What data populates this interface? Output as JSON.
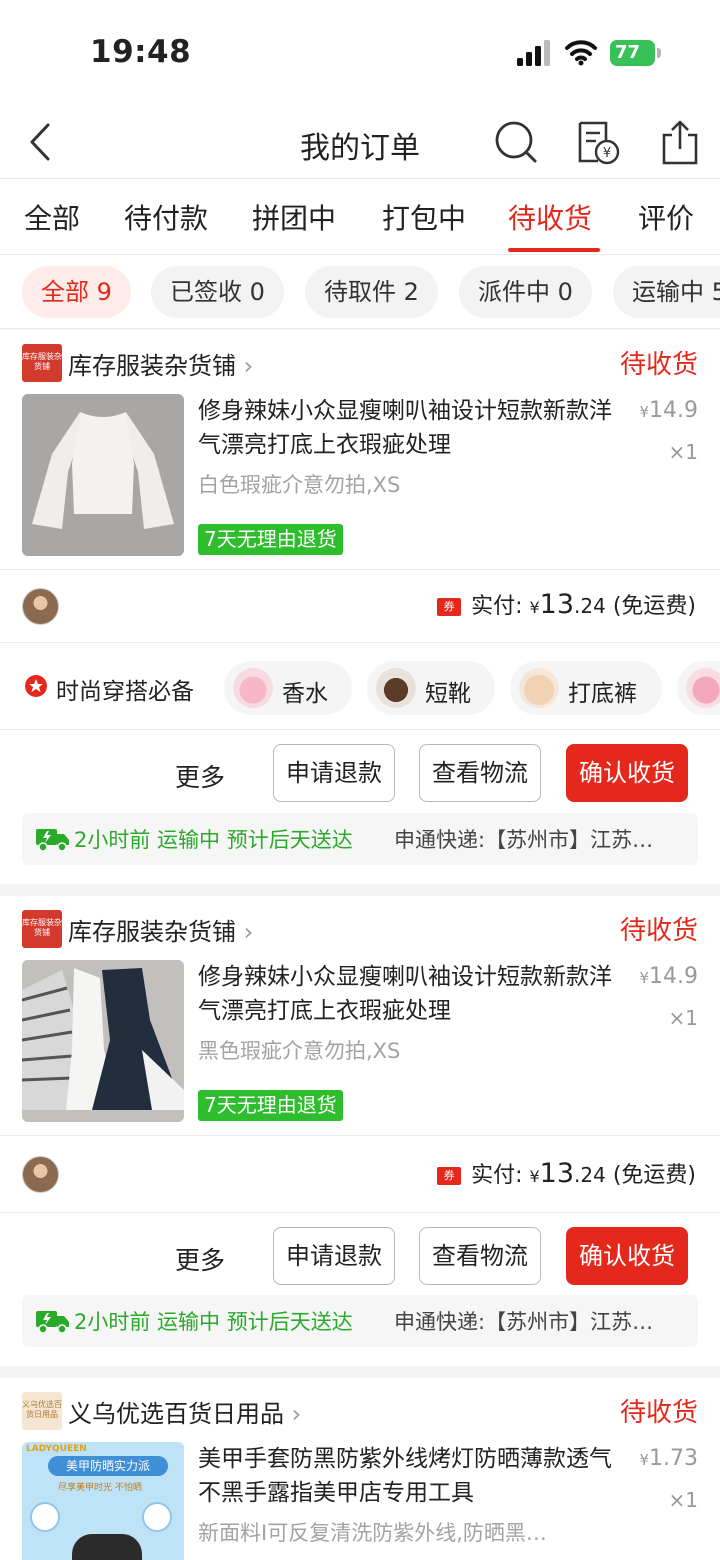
{
  "status_bar": {
    "time": "19:48",
    "battery": "77"
  },
  "nav": {
    "title": "我的订单"
  },
  "tabs": [
    "全部",
    "待付款",
    "拼团中",
    "打包中",
    "待收货",
    "评价"
  ],
  "chips": [
    "全部 9",
    "已签收 0",
    "待取件 2",
    "派件中 0",
    "运输中 5"
  ],
  "orders": [
    {
      "shop_name": "库存服装杂货铺",
      "shop_logo": "库存服装杂货铺",
      "status": "待收货",
      "title": "修身辣妹小众显瘦喇叭袖设计短款新款洋气漂亮打底上衣瑕疵处理",
      "price_symbol": "¥",
      "price": "14.9",
      "qty": "×1",
      "spec": "白色瑕疵介意勿拍,XS",
      "tag": "7天无理由退货",
      "coupon": "券",
      "pay_label": "实付: ",
      "pay_symbol": "¥",
      "pay_int": "13",
      "pay_dec": ".24",
      "pay_note": " (免运费)"
    },
    {
      "shop_name": "库存服装杂货铺",
      "shop_logo": "库存服装杂货铺",
      "status": "待收货",
      "title": "修身辣妹小众显瘦喇叭袖设计短款新款洋气漂亮打底上衣瑕疵处理",
      "price_symbol": "¥",
      "price": "14.9",
      "qty": "×1",
      "spec": "黑色瑕疵介意勿拍,XS",
      "tag": "7天无理由退货",
      "coupon": "券",
      "pay_label": "实付: ",
      "pay_symbol": "¥",
      "pay_int": "13",
      "pay_dec": ".24",
      "pay_note": " (免运费)"
    },
    {
      "shop_name": "义乌优选百货日用品",
      "shop_logo": "义乌优选百货日用品",
      "status": "待收货",
      "title": "美甲手套防黑防紫外线烤灯防晒薄款透气不黑手露指美甲店专用工具",
      "price_symbol": "¥",
      "price": "1.73",
      "qty": "×1",
      "spec": "新面料I可反复清洗防紫外线,防晒黑…",
      "image_text": {
        "brand": "LADYQUEEN",
        "headline": "美甲防晒实力派",
        "sub": "尽享美甲时光 不怕晒"
      }
    }
  ],
  "recommend": {
    "title": "时尚穿搭必备",
    "items": [
      "香水",
      "短靴",
      "打底裤"
    ]
  },
  "actions": {
    "more": "更多",
    "refund": "申请退款",
    "logistics": "查看物流",
    "confirm": "确认收货"
  },
  "logistics": {
    "status": "2小时前 运输中 预计后天送达",
    "carrier": "申通快递:【苏州市】江苏…"
  },
  "colors": {
    "accent": "#e4291c",
    "green": "#2dbd2d"
  }
}
